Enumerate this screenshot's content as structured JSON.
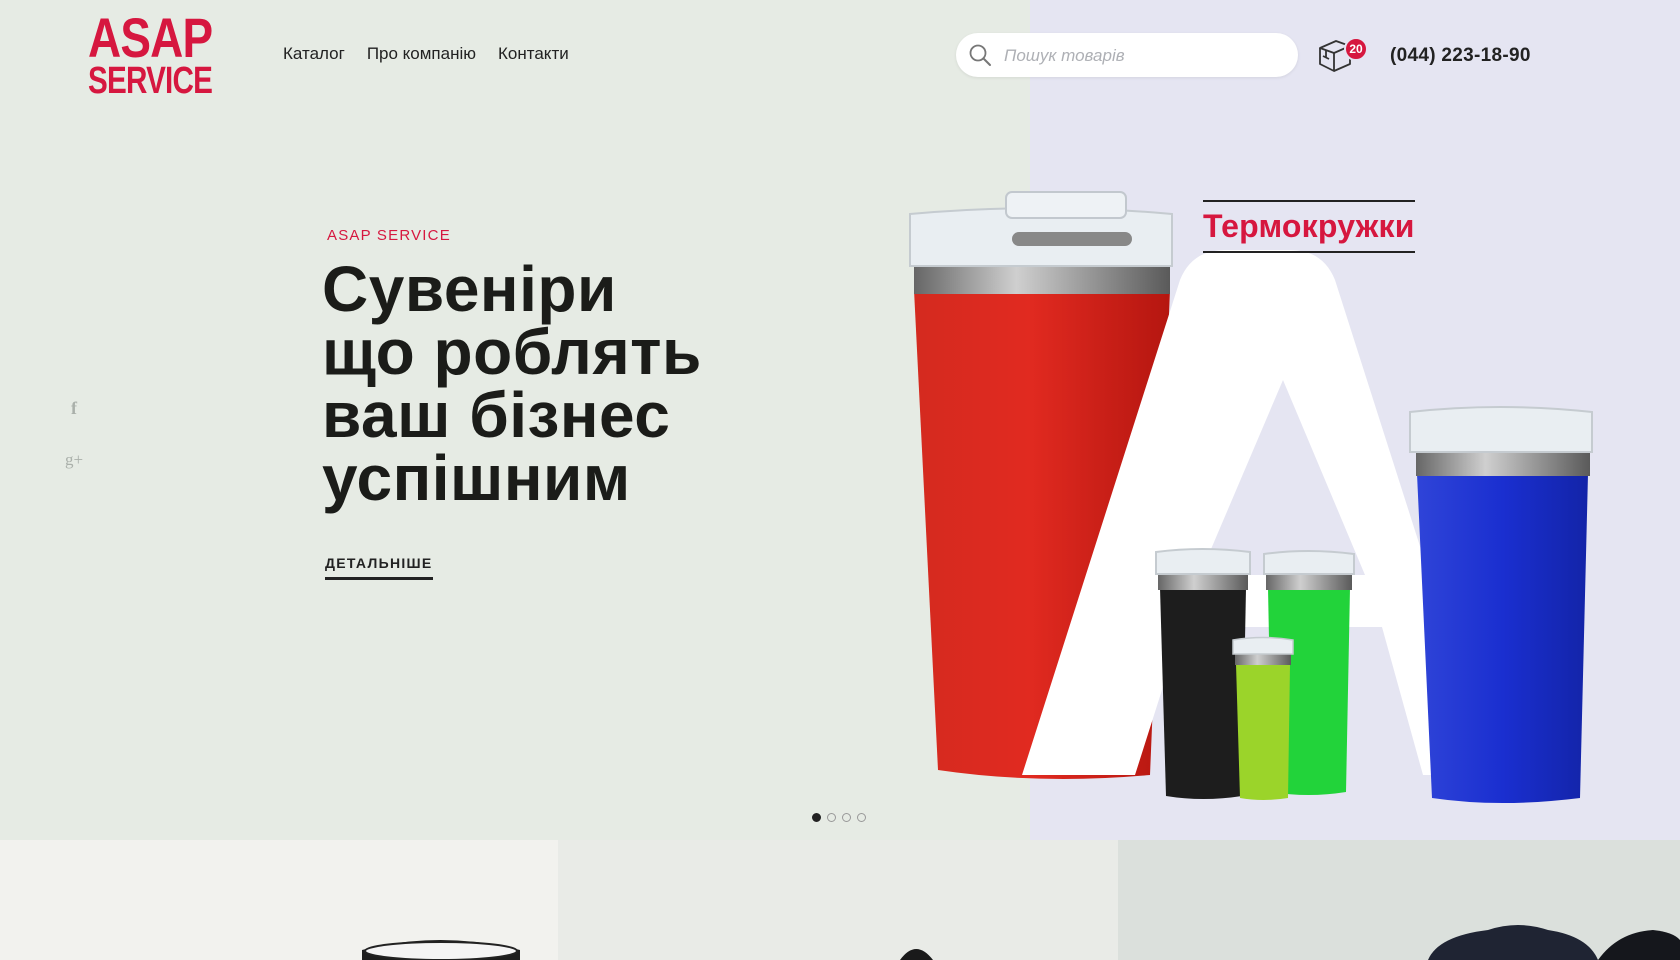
{
  "brand": {
    "logo_line1": "ASAP",
    "logo_line2": "SERVICE",
    "accent": "#d6173f"
  },
  "nav": {
    "items": [
      {
        "label": "Каталог"
      },
      {
        "label": "Про компанію"
      },
      {
        "label": "Контакти"
      }
    ]
  },
  "search": {
    "placeholder": "Пошук товарів",
    "icon": "search-icon"
  },
  "cart": {
    "count": "20",
    "icon": "box-cart-icon"
  },
  "phone": "(044) 223-18-90",
  "social": {
    "facebook": "f",
    "google_plus": "g+"
  },
  "hero": {
    "eyebrow": "ASAP SERVICE",
    "headline_lines": [
      "Сувеніри",
      "що роблять",
      "ваш бізнес",
      "успішним"
    ],
    "cta": "ДЕТАЛЬНІШЕ",
    "category_label": "Термокружки",
    "slides_total": 4,
    "slide_active": 1,
    "colors": {
      "left_bg": "#e6ebe4",
      "right_bg": "#e5e5f2"
    }
  },
  "categories": [
    {
      "icon": "mug-image"
    },
    {
      "icon": "cap-image"
    },
    {
      "icon": "jacket-image"
    }
  ]
}
